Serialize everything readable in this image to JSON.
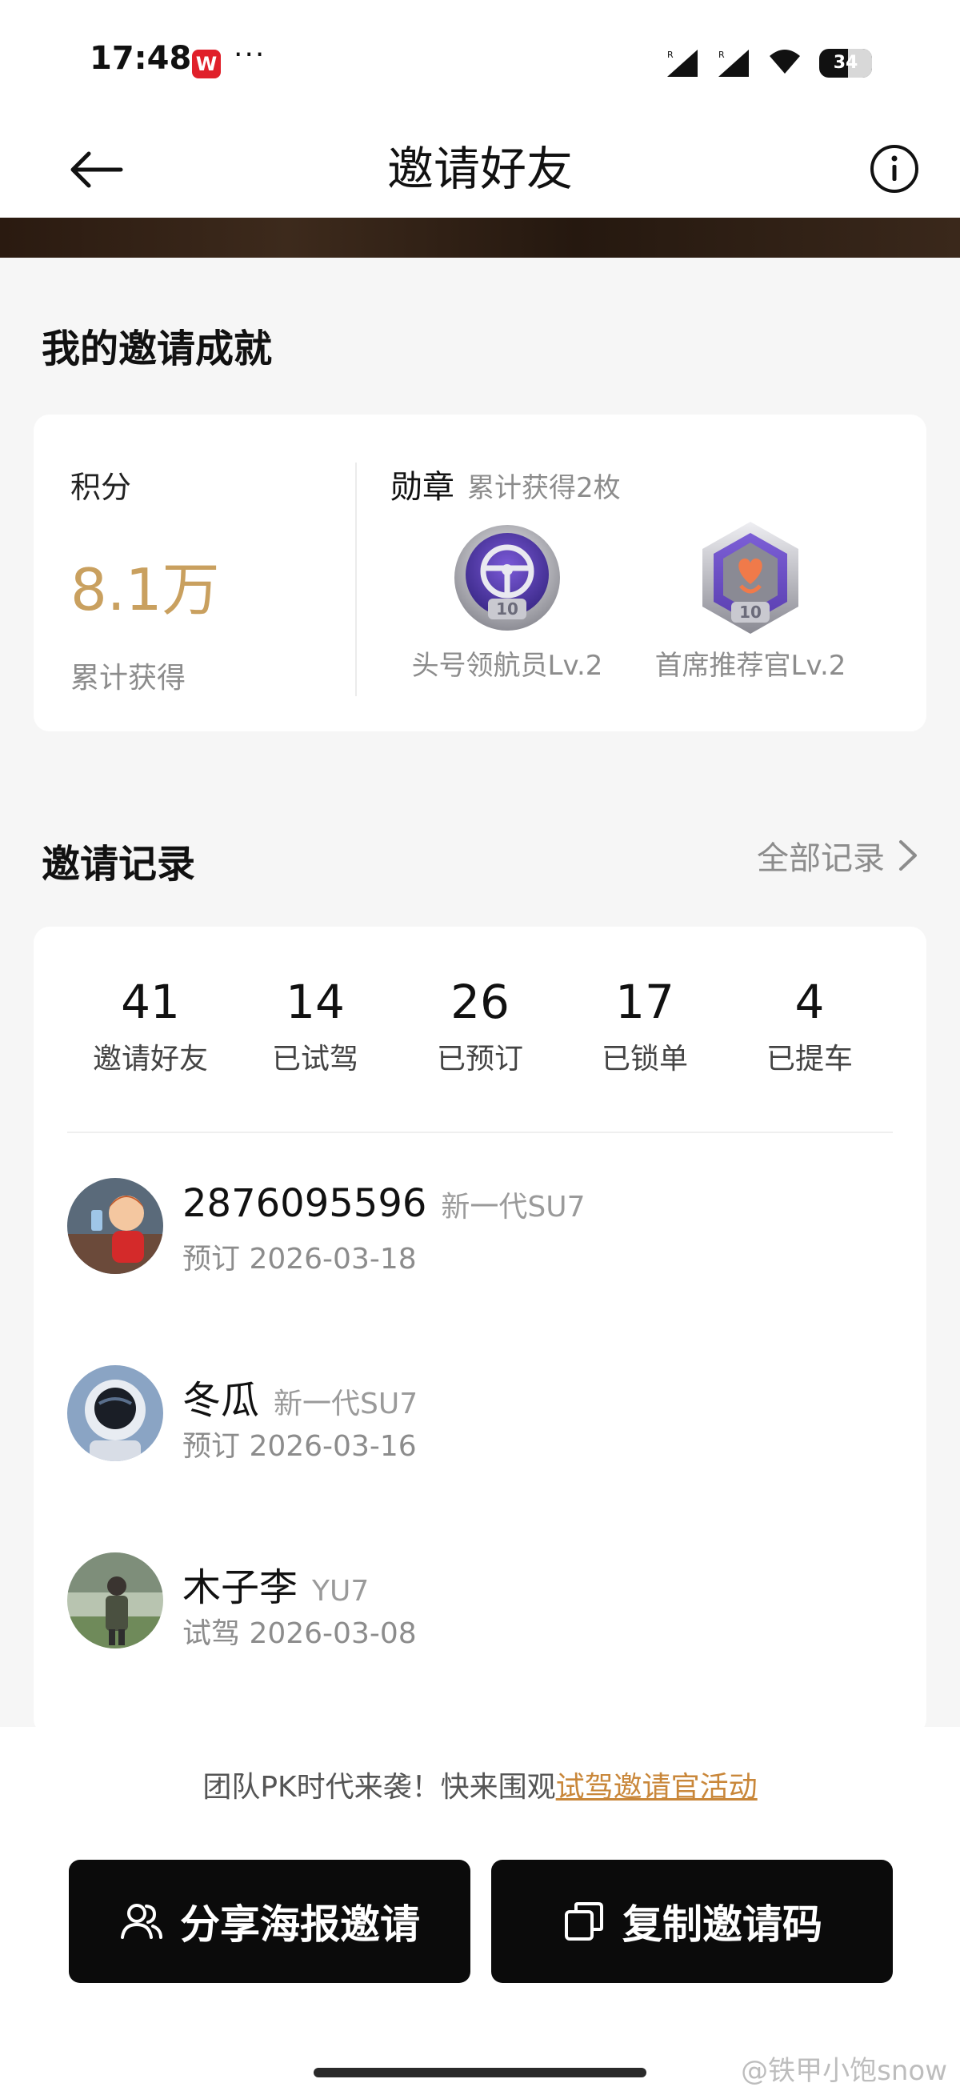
{
  "status_bar": {
    "time": "17:48",
    "app_badge": "W",
    "more": "···",
    "battery": "34"
  },
  "header": {
    "title": "邀请好友",
    "back_icon": "arrow-left-icon",
    "info_icon": "info-circle-icon"
  },
  "achievements": {
    "section_title": "我的邀请成就",
    "points_label": "积分",
    "points_value": "8.1万",
    "points_sub": "累计获得",
    "badges_title": "勋章",
    "badges_sub": "累计获得2枚",
    "badges": [
      {
        "name": "头号领航员Lv.2",
        "icon": "steering-wheel-badge-icon",
        "level": "10"
      },
      {
        "name": "首席推荐官Lv.2",
        "icon": "heart-badge-icon",
        "level": "10"
      }
    ]
  },
  "records": {
    "section_title": "邀请记录",
    "all_link": "全部记录",
    "stats": [
      {
        "num": "41",
        "label": "邀请好友"
      },
      {
        "num": "14",
        "label": "已试驾"
      },
      {
        "num": "26",
        "label": "已预订"
      },
      {
        "num": "17",
        "label": "已锁单"
      },
      {
        "num": "4",
        "label": "已提车"
      }
    ],
    "items": [
      {
        "name": "2876095596",
        "model": "新一代SU7",
        "status": "预订 2026-03-18"
      },
      {
        "name": "冬瓜",
        "model": "新一代SU7",
        "status": "预订 2026-03-16"
      },
      {
        "name": "木子李",
        "model": "YU7",
        "status": "试驾 2026-03-08"
      }
    ]
  },
  "footer": {
    "promo_text": "团队PK时代来袭！快来围观",
    "promo_link": "试驾邀请官活动",
    "share_button": "分享海报邀请",
    "copy_button": "复制邀请码",
    "watermark": "@铁甲小饱snow"
  },
  "colors": {
    "accent_gold": "#c9a05f",
    "link_orange": "#c9873a",
    "button_black": "#0b0b0b"
  }
}
